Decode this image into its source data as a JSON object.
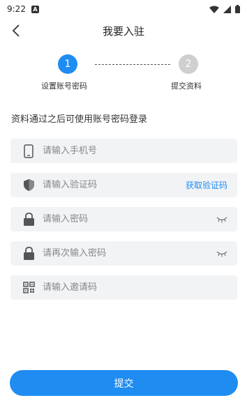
{
  "status_bar": {
    "time": "9:22",
    "notification_letter": "A"
  },
  "header": {
    "title": "我要入驻"
  },
  "steps": [
    {
      "number": "1",
      "label": "设置账号密码",
      "active": true
    },
    {
      "number": "2",
      "label": "提交资料",
      "active": false
    }
  ],
  "hint_text": "资料通过之后可使用账号密码登录",
  "form": {
    "phone": {
      "placeholder": "请输入手机号",
      "icon": "phone-icon"
    },
    "code": {
      "placeholder": "请输入验证码",
      "icon": "shield-icon",
      "action_label": "获取验证码"
    },
    "password": {
      "placeholder": "请输入密码",
      "icon": "lock-icon"
    },
    "confirm_password": {
      "placeholder": "请再次输入密码",
      "icon": "lock-icon"
    },
    "invite_code": {
      "placeholder": "请输入邀请码",
      "icon": "qr-code-icon"
    }
  },
  "submit_label": "提交",
  "colors": {
    "accent": "#1f8cf2",
    "field_bg": "#f2f3f5",
    "inactive_step": "#cfcfcf"
  }
}
